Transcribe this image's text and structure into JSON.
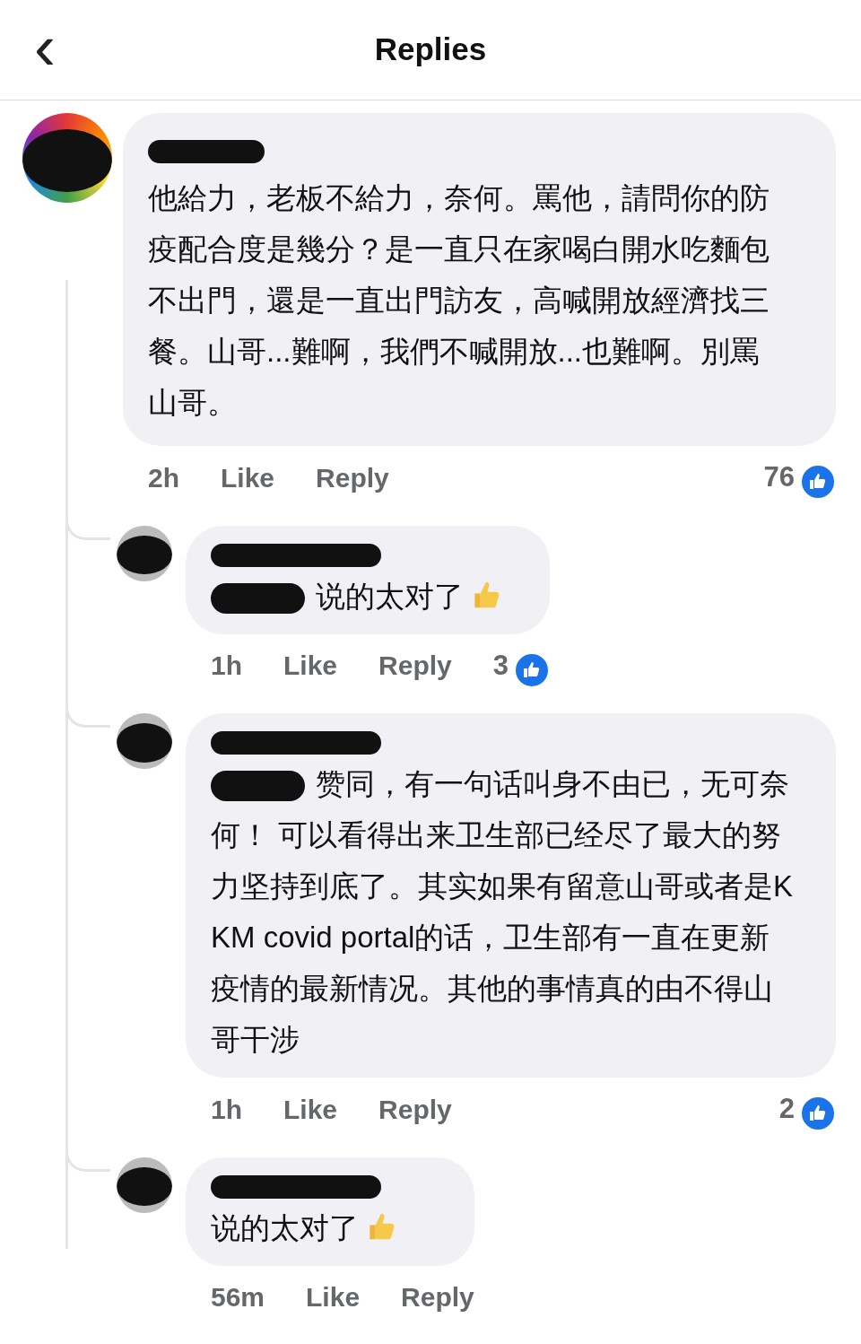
{
  "header": {
    "back": "‹",
    "title": "Replies"
  },
  "comment": {
    "text": "他給力，老板不給力，奈何。罵他，請問你的防疫配合度是幾分？是一直只在家喝白開水吃麵包不出門，還是一直出門訪友，高喊開放經濟找三餐。山哥...難啊，我們不喊開放...也難啊。別罵山哥。",
    "mention_redacted": false,
    "thumbs_up": false,
    "time": "2h",
    "like": "Like",
    "reply": "Reply",
    "reactions": "76"
  },
  "replies": [
    {
      "text": "说的太对了",
      "mention_redacted": true,
      "thumbs_up": true,
      "time": "1h",
      "like": "Like",
      "reply": "Reply",
      "reactions": "3"
    },
    {
      "text": "赞同，有一句话叫身不由已，无可奈何！ 可以看得出来卫生部已经尽了最大的努力坚持到底了。其实如果有留意山哥或者是KKM covid portal的话，卫生部有一直在更新疫情的最新情况。其他的事情真的由不得山哥干涉",
      "mention_redacted": true,
      "thumbs_up": false,
      "time": "1h",
      "like": "Like",
      "reply": "Reply",
      "reactions": "2"
    },
    {
      "text": "说的太对了",
      "mention_redacted": false,
      "thumbs_up": true,
      "time": "56m",
      "like": "Like",
      "reply": "Reply"
    }
  ]
}
